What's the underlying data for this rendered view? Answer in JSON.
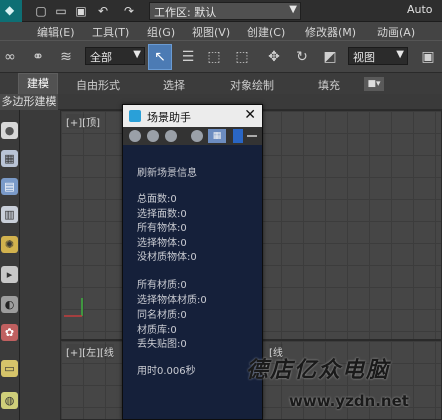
{
  "titlebar": {
    "workspace_label": "工作区: 默认",
    "app_title": "Auto"
  },
  "menu": {
    "items": [
      "编辑(E)",
      "工具(T)",
      "组(G)",
      "视图(V)",
      "创建(C)",
      "修改器(M)",
      "动画(A)"
    ]
  },
  "toolbar": {
    "filter_value": "全部",
    "view_value": "视图"
  },
  "ribbon": {
    "tabs": [
      "建模",
      "自由形式",
      "选择",
      "对象绘制",
      "填充"
    ]
  },
  "polybar": {
    "label": "多边形建模"
  },
  "viewports": {
    "top_left_label": "[+][顶]",
    "bottom_left_label": "[+][左][线",
    "bottom_right_label": "[线"
  },
  "dialog": {
    "title": "场景助手",
    "lines": [
      "刷新场景信息",
      "总面数:0",
      "选择面数:0",
      "所有物体:0",
      "选择物体:0",
      "没材质物体:0",
      "所有材质:0",
      "选择物体材质:0",
      "同名材质:0",
      "材质库:0",
      "丢失贴图:0",
      "用时0.006秒"
    ]
  },
  "watermark": {
    "text": "德店亿众电脑",
    "url": "www.yzdn.net"
  }
}
